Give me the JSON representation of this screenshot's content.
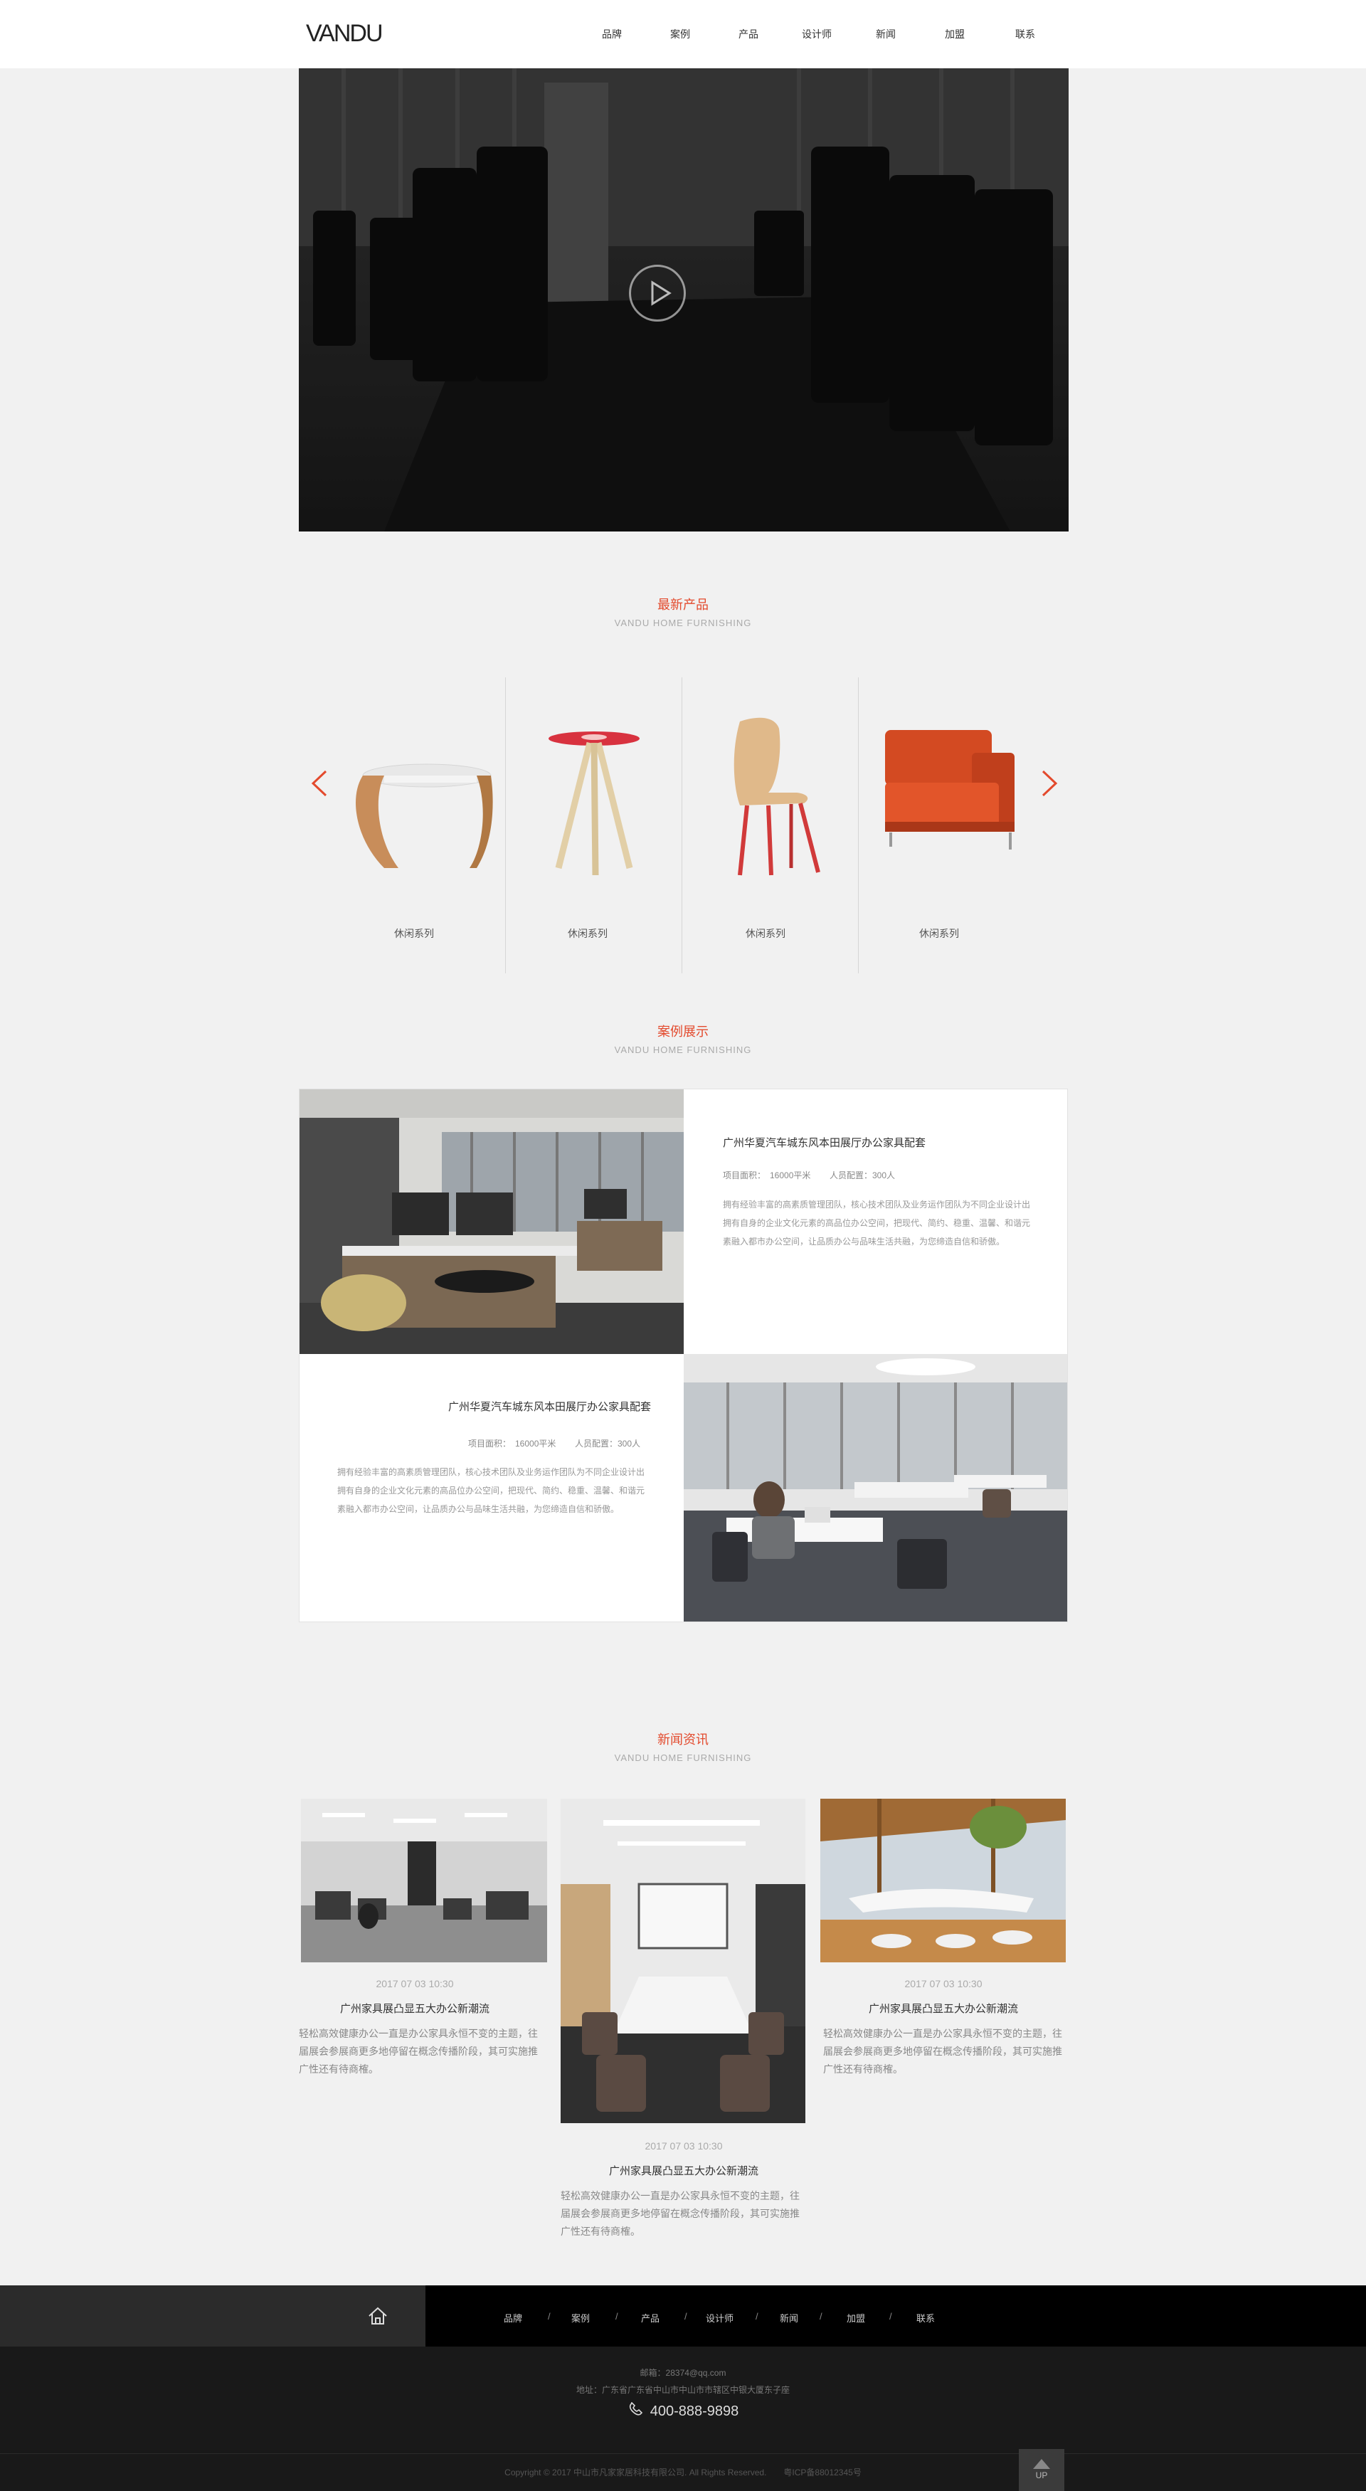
{
  "header": {
    "logo": "VANDU",
    "nav": [
      "品牌",
      "案例",
      "产品",
      "设计师",
      "新闻",
      "加盟",
      "联系"
    ]
  },
  "products": {
    "title": "最新产品",
    "subtitle": "VANDU HOME FURNISHING",
    "items": [
      "休闲系列",
      "休闲系列",
      "休闲系列",
      "休闲系列"
    ]
  },
  "cases": {
    "title": "案例展示",
    "subtitle": "VANDU HOME FURNISHING",
    "items": [
      {
        "title": "广州华夏汽车城东风本田展厅办公家具配套",
        "area": "项目面积：　16000平米",
        "people": "人员配置：300人",
        "desc": "拥有经验丰富的高素质管理团队，核心技术团队及业务运作团队为不同企业设计出拥有自身的企业文化元素的高品位办公空间，把现代、简约、稳重、温馨、和谐元素融入都市办公空间，让品质办公与品味生活共融，为您缔造自信和骄傲。"
      },
      {
        "title": "广州华夏汽车城东风本田展厅办公家具配套",
        "area": "项目面积：　16000平米",
        "people": "人员配置：300人",
        "desc": "拥有经验丰富的高素质管理团队，核心技术团队及业务运作团队为不同企业设计出拥有自身的企业文化元素的高品位办公空间，把现代、简约、稳重、温馨、和谐元素融入都市办公空间，让品质办公与品味生活共融，为您缔造自信和骄傲。"
      }
    ]
  },
  "news": {
    "title": "新闻资讯",
    "subtitle": "VANDU HOME FURNISHING",
    "items": [
      {
        "date": "2017 07 03 10:30",
        "title": "广州家具展凸显五大办公新潮流",
        "desc": "轻松高效健康办公一直是办公家具永恒不变的主题，往届展会参展商更多地停留在概念传播阶段，其可实施推广性还有待商榷。"
      },
      {
        "date": "2017 07 03 10:30",
        "title": "广州家具展凸显五大办公新潮流",
        "desc": "轻松高效健康办公一直是办公家具永恒不变的主题，往届展会参展商更多地停留在概念传播阶段，其可实施推广性还有待商榷。"
      },
      {
        "date": "2017 07 03 10:30",
        "title": "广州家具展凸显五大办公新潮流",
        "desc": "轻松高效健康办公一直是办公家具永恒不变的主题，往届展会参展商更多地停留在概念传播阶段，其可实施推广性还有待商榷。"
      }
    ]
  },
  "footer": {
    "nav": [
      "品牌",
      "案例",
      "产品",
      "设计师",
      "新闻",
      "加盟",
      "联系"
    ],
    "separator": "/",
    "email": "邮箱：28374@qq.com",
    "address": "地址：广东省广东省中山市中山市市辖区中银大厦东子座",
    "phone": "400-888-9898",
    "copyright": "Copyright © 2017 中山市凡家家居科技有限公司. All Rights Reserved.　　粤ICP备88012345号",
    "up_label": "UP"
  },
  "colors": {
    "accent": "#e34a2d",
    "footer_bg": "#191919",
    "page_bg": "#f1f1f1"
  }
}
